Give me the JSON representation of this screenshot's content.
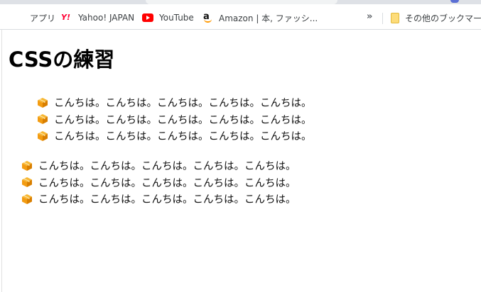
{
  "bookmarks": {
    "apps_label": "アプリ",
    "yahoo_label": "Yahoo! JAPAN",
    "yahoo_icon_text": "Y!",
    "youtube_label": "YouTube",
    "amazon_label": "Amazon | 本, ファッシ...",
    "amazon_icon_text": "a",
    "overflow_label": "»",
    "other_bookmarks_label": "その他のブックマーク"
  },
  "page": {
    "title": "CSSの練習",
    "list1": [
      "こんちは。こんちは。こんちは。こんちは。こんちは。",
      "こんちは。こんちは。こんちは。こんちは。こんちは。",
      "こんちは。こんちは。こんちは。こんちは。こんちは。"
    ],
    "list2": [
      "こんちは。こんちは。こんちは。こんちは。こんちは。",
      "こんちは。こんちは。こんちは。こんちは。こんちは。",
      "こんちは。こんちは。こんちは。こんちは。こんちは。"
    ]
  },
  "icons": {
    "list_bullet": "package-box-icon",
    "colors": {
      "box_orange": "#f39c12",
      "box_dark": "#d97f00"
    }
  }
}
